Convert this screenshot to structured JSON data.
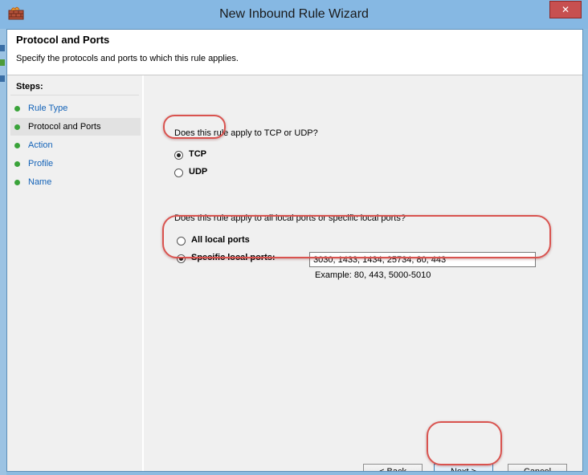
{
  "window": {
    "title": "New Inbound Rule Wizard",
    "close_glyph": "✕",
    "app_icon": "firewall-icon"
  },
  "header": {
    "title": "Protocol and Ports",
    "subtitle": "Specify the protocols and ports to which this rule applies."
  },
  "steps": {
    "label": "Steps:",
    "items": [
      {
        "label": "Rule Type",
        "active": false
      },
      {
        "label": "Protocol and Ports",
        "active": true
      },
      {
        "label": "Action",
        "active": false
      },
      {
        "label": "Profile",
        "active": false
      },
      {
        "label": "Name",
        "active": false
      }
    ]
  },
  "protocol": {
    "question": "Does this rule apply to TCP or UDP?",
    "options": [
      {
        "label": "TCP",
        "checked": true
      },
      {
        "label": "UDP",
        "checked": false
      }
    ]
  },
  "ports": {
    "question": "Does this rule apply to all local ports or specific local ports?",
    "all_label": "All local ports",
    "specific_label": "Specific local ports:",
    "specific_checked": true,
    "value": "3030, 1433, 1434, 25734, 80, 443",
    "example": "Example: 80, 443, 5000-5010"
  },
  "buttons": {
    "back": "< Back",
    "next": "Next >",
    "cancel": "Cancel"
  },
  "colors": {
    "annotation": "#d9534f",
    "step_dot": "#3aa33a",
    "step_link": "#1463b8"
  }
}
